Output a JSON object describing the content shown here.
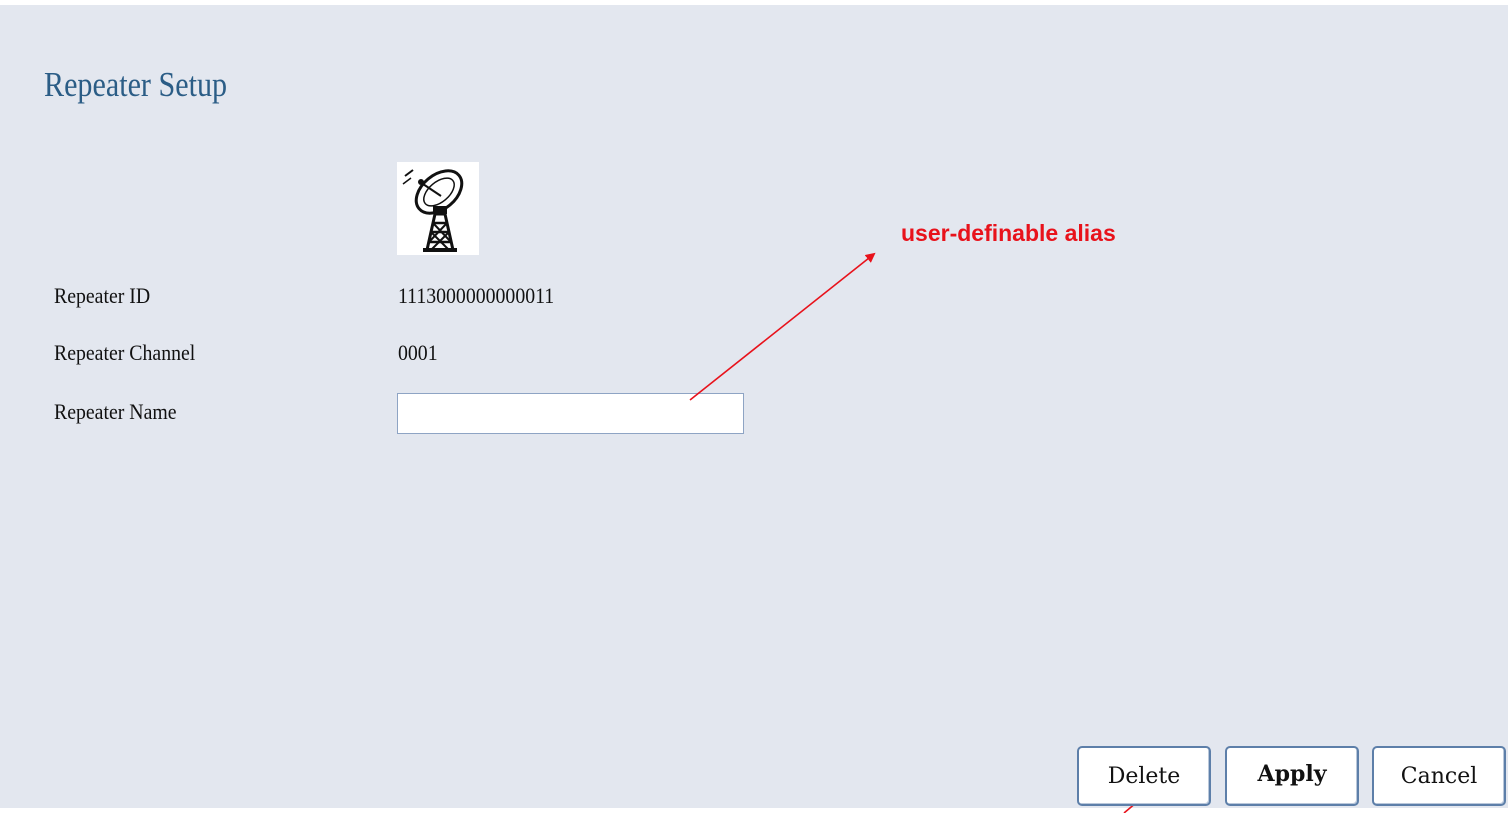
{
  "page": {
    "title": "Repeater Setup"
  },
  "device_icon": "satellite-dish-tower-icon",
  "fields": {
    "repeater_id": {
      "label": "Repeater ID",
      "value": "1113000000000011"
    },
    "repeater_channel": {
      "label": "Repeater Channel",
      "value": "0001"
    },
    "repeater_name": {
      "label": "Repeater Name",
      "value": ""
    }
  },
  "buttons": {
    "delete": "Delete",
    "apply": "Apply",
    "cancel": "Cancel"
  },
  "annotation": {
    "text": "user-definable alias",
    "color": "#e8121b"
  },
  "colors": {
    "background": "#e3e7ef",
    "title": "#2b5d86",
    "button_border": "#5d7fa9"
  }
}
